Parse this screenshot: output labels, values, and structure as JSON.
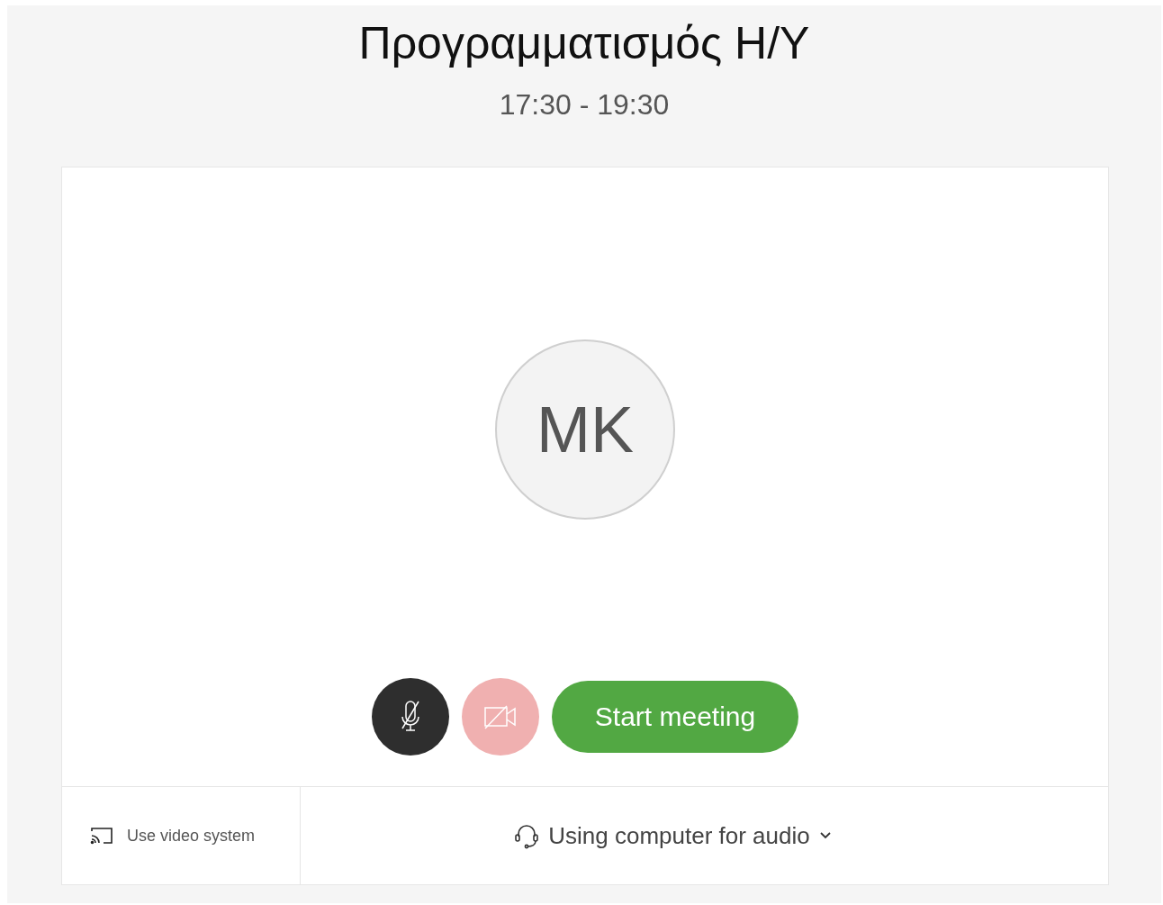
{
  "meeting": {
    "title": "Προγραμματισμός Η/Υ",
    "time": "17:30 - 19:30"
  },
  "avatar": {
    "initials": "MK"
  },
  "controls": {
    "mic_muted": true,
    "video_off": true,
    "start_label": "Start meeting"
  },
  "footer": {
    "video_system": "Use video system",
    "audio": "Using computer for audio"
  }
}
